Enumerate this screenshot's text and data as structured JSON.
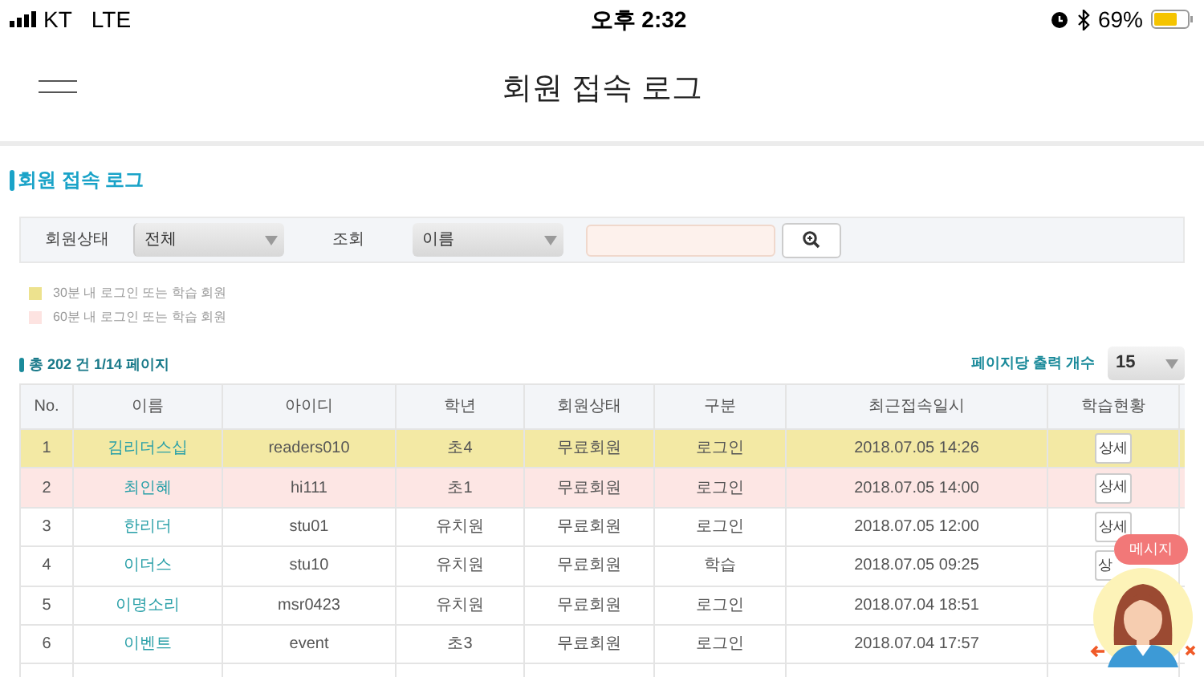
{
  "status_bar": {
    "carrier": "KT",
    "network": "LTE",
    "time": "오후 2:32",
    "battery": "69%"
  },
  "header": {
    "title": "회원 접속 로그"
  },
  "section_title": "회원 접속 로그",
  "filters": {
    "status_label": "회원상태",
    "status_value": "전체",
    "search_label": "조회",
    "search_type": "이름"
  },
  "legend": [
    {
      "label": "30분 내 로그인 또는 학습 회원",
      "color": "#ede28e"
    },
    {
      "label": "60분 내 로그인 또는 학습 회원",
      "color": "#fde3e1"
    }
  ],
  "summary": "총 202 건 1/14 페이지",
  "per_page": {
    "label": "페이지당 출력 개수",
    "value": "15"
  },
  "table": {
    "columns": [
      "No.",
      "이름",
      "아이디",
      "학년",
      "회원상태",
      "구분",
      "최근접속일시",
      "학습현황"
    ],
    "rows": [
      {
        "no": "1",
        "name": "김리더스십",
        "id": "readers010",
        "grade": "초4",
        "status": "무료회원",
        "type": "로그인",
        "time": "2018.07.05 14:26",
        "detail": "상세",
        "color": "#f3e9a4"
      },
      {
        "no": "2",
        "name": "최인혜",
        "id": "hi111",
        "grade": "초1",
        "status": "무료회원",
        "type": "로그인",
        "time": "2018.07.05 14:00",
        "detail": "상세",
        "color": "#fde6e4"
      },
      {
        "no": "3",
        "name": "한리더",
        "id": "stu01",
        "grade": "유치원",
        "status": "무료회원",
        "type": "로그인",
        "time": "2018.07.05 12:00",
        "detail": "상세"
      },
      {
        "no": "4",
        "name": "이더스",
        "id": "stu10",
        "grade": "유치원",
        "status": "무료회원",
        "type": "학습",
        "time": "2018.07.05 09:25",
        "detail": "상",
        "detail_cut": true
      },
      {
        "no": "5",
        "name": "이명소리",
        "id": "msr0423",
        "grade": "유치원",
        "status": "무료회원",
        "type": "로그인",
        "time": "2018.07.04 18:51"
      },
      {
        "no": "6",
        "name": "이벤트",
        "id": "event",
        "grade": "초3",
        "status": "무료회원",
        "type": "로그인",
        "time": "2018.07.04 17:57"
      }
    ]
  },
  "chat_widget": {
    "bubble": "메시지"
  }
}
